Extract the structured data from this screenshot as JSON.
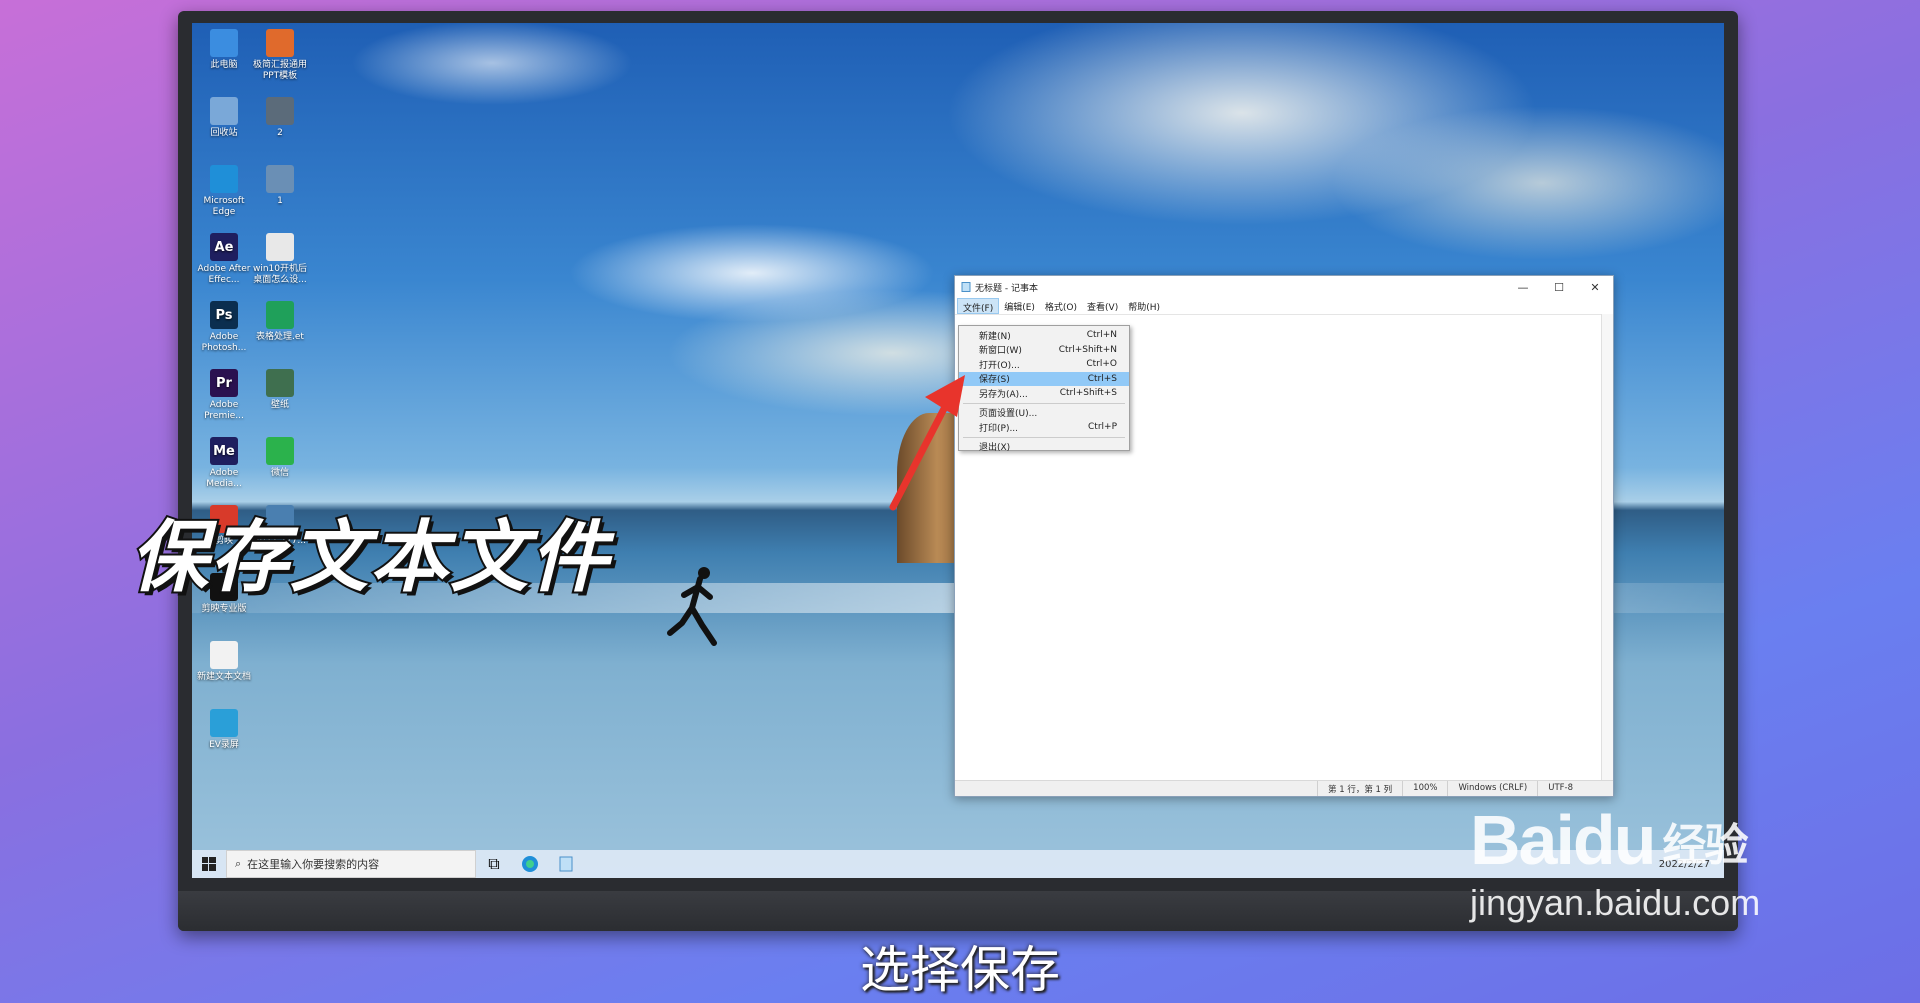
{
  "desktop_icons": [
    {
      "label": "此电脑",
      "icon": "computer-icon",
      "color": "#3b8de0"
    },
    {
      "label": "极简汇报通用PPT模板",
      "icon": "ppt-icon",
      "color": "#e06a2c"
    },
    {
      "label": "回收站",
      "icon": "recycle-bin-icon",
      "color": "#7aa8d8"
    },
    {
      "label": "2",
      "icon": "image-icon",
      "color": "#5b6b7a"
    },
    {
      "label": "Microsoft Edge",
      "icon": "edge-icon",
      "color": "#1f8fd8"
    },
    {
      "label": "1",
      "icon": "image-icon",
      "color": "#6a8fb5"
    },
    {
      "label": "Adobe After Effec...",
      "icon": "ae-icon",
      "badge": "Ae",
      "color": "#1f1f5f"
    },
    {
      "label": "win10开机后桌面怎么设...",
      "icon": "document-icon",
      "color": "#e8e8e8"
    },
    {
      "label": "Adobe Photosh...",
      "icon": "ps-icon",
      "badge": "Ps",
      "color": "#0b2e4f"
    },
    {
      "label": "表格处理.et",
      "icon": "spreadsheet-icon",
      "color": "#1fa05a"
    },
    {
      "label": "Adobe Premie...",
      "icon": "pr-icon",
      "badge": "Pr",
      "color": "#2a1150"
    },
    {
      "label": "壁纸",
      "icon": "image-icon",
      "color": "#3f6f4f"
    },
    {
      "label": "Adobe Media...",
      "icon": "me-icon",
      "badge": "Me",
      "color": "#1f1f5f"
    },
    {
      "label": "微信",
      "icon": "wechat-icon",
      "color": "#2bb24c"
    },
    {
      "label": "剪映",
      "icon": "app-icon",
      "color": "#d83a2a"
    },
    {
      "label": "2022-227...",
      "icon": "image-icon",
      "color": "#4a7fb0"
    },
    {
      "label": "剪映专业版",
      "icon": "capcut-icon",
      "color": "#111"
    },
    {
      "label": "新建文本文档",
      "icon": "text-file-icon",
      "color": "#f2f2f2"
    },
    {
      "label": "EV录屏",
      "icon": "ev-icon",
      "color": "#2a9fd8"
    }
  ],
  "taskbar": {
    "search_placeholder": "在这里输入你要搜索的内容",
    "tray_text": "2022/2/27"
  },
  "notepad": {
    "title": "无标题 - 记事本",
    "controls": {
      "minimize": "—",
      "maximize": "☐",
      "close": "✕"
    },
    "menus": [
      "文件(F)",
      "编辑(E)",
      "格式(O)",
      "查看(V)",
      "帮助(H)"
    ],
    "file_menu": [
      {
        "label": "新建(N)",
        "shortcut": "Ctrl+N"
      },
      {
        "label": "新窗口(W)",
        "shortcut": "Ctrl+Shift+N"
      },
      {
        "label": "打开(O)...",
        "shortcut": "Ctrl+O"
      },
      {
        "label": "保存(S)",
        "shortcut": "Ctrl+S",
        "highlighted": true
      },
      {
        "label": "另存为(A)...",
        "shortcut": "Ctrl+Shift+S"
      },
      {
        "separator": true
      },
      {
        "label": "页面设置(U)...",
        "shortcut": ""
      },
      {
        "label": "打印(P)...",
        "shortcut": "Ctrl+P"
      },
      {
        "separator": true
      },
      {
        "label": "退出(X)",
        "shortcut": ""
      }
    ],
    "status": {
      "position": "第 1 行，第 1 列",
      "zoom": "100%",
      "line_ending": "Windows (CRLF)",
      "encoding": "UTF-8"
    }
  },
  "overlay": {
    "headline": "保存文本文件",
    "caption": "选择保存"
  },
  "watermark": {
    "logo": "Baidu",
    "logo_cn": "经验",
    "url": "jingyan.baidu.com"
  },
  "colors": {
    "highlight": "#91c9f7",
    "arrow": "#e8342c"
  }
}
